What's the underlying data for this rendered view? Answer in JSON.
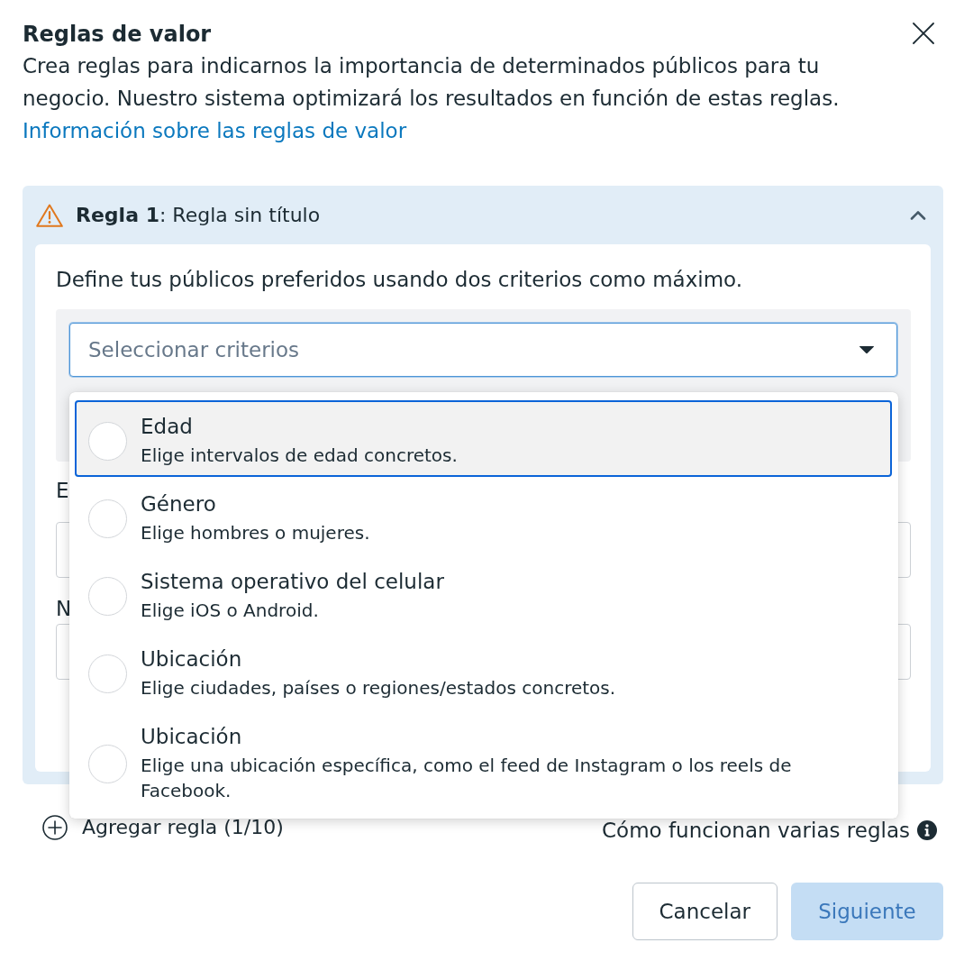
{
  "dialog": {
    "title": "Reglas de valor",
    "description": "Crea reglas para indicarnos la importancia de determinados públicos para tu negocio. Nuestro sistema optimizará los resultados en función de estas reglas.",
    "link": "Información sobre las reglas de valor"
  },
  "rule": {
    "heading": "**Regla 1**: Regla sin título",
    "warning": true,
    "expanded": true,
    "instruction": "Define tus públicos preferidos usando dos criterios como máximo.",
    "criteria_select": {
      "placeholder": "Seleccionar criterios",
      "open": true,
      "options": [
        {
          "title": "Edad",
          "description": "Elige intervalos de edad concretos.",
          "highlighted": true,
          "checked": false
        },
        {
          "title": "Género",
          "description": "Elige hombres o mujeres.",
          "highlighted": false,
          "checked": false
        },
        {
          "title": "Sistema operativo del celular",
          "description": "Elige iOS o Android.",
          "highlighted": false,
          "checked": false
        },
        {
          "title": "Ubicación",
          "description": "Elige ciudades, países o regiones/estados concretos.",
          "highlighted": false,
          "checked": false
        },
        {
          "title": "Ubicación",
          "description": "Elige una ubicación específica, como el feed de Instagram o los reels de Facebook.",
          "highlighted": false,
          "checked": false
        }
      ]
    },
    "fields": [
      {
        "label": "E"
      },
      {
        "label": "N"
      }
    ]
  },
  "add_rule": "Agregar regla (1/10)",
  "help_text": "Cómo funcionan varias reglas",
  "buttons": [
    {
      "label": "Cancelar",
      "kind": "secondary",
      "disabled": false
    },
    {
      "label": "Siguiente",
      "kind": "primary",
      "disabled": true
    }
  ]
}
